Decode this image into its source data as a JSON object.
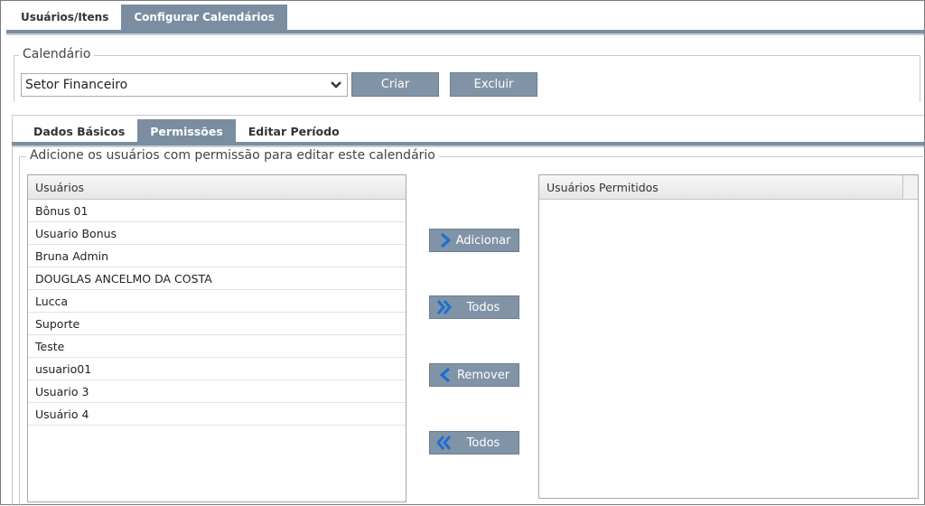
{
  "top_tabs": [
    {
      "label": "Usuários/Itens",
      "active": false
    },
    {
      "label": "Configurar Calendários",
      "active": true
    }
  ],
  "calendar": {
    "legend": "Calendário",
    "selected": "Setor Financeiro",
    "create_label": "Criar",
    "delete_label": "Excluir"
  },
  "inner_tabs": [
    {
      "label": "Dados Básicos",
      "active": false
    },
    {
      "label": "Permissões",
      "active": true
    },
    {
      "label": "Editar Período",
      "active": false
    }
  ],
  "permissions": {
    "legend": "Adicione os usuários com permissão para editar este calendário",
    "users_header": "Usuários",
    "users": [
      "Bônus 01",
      "Usuario Bonus",
      "Bruna Admin",
      "DOUGLAS ANCELMO DA COSTA",
      "Lucca",
      "Suporte",
      "Teste",
      "usuario01",
      "Usuario 3",
      "Usuário 4"
    ],
    "allowed_header": "Usuários Permitidos",
    "allowed": [],
    "add_label": "Adicionar",
    "add_all_label": "Todos",
    "remove_label": "Remover",
    "remove_all_label": "Todos"
  },
  "colors": {
    "accent": "#7b8da0",
    "button": "#8193a6",
    "icon_blue": "#1f6fd1"
  }
}
